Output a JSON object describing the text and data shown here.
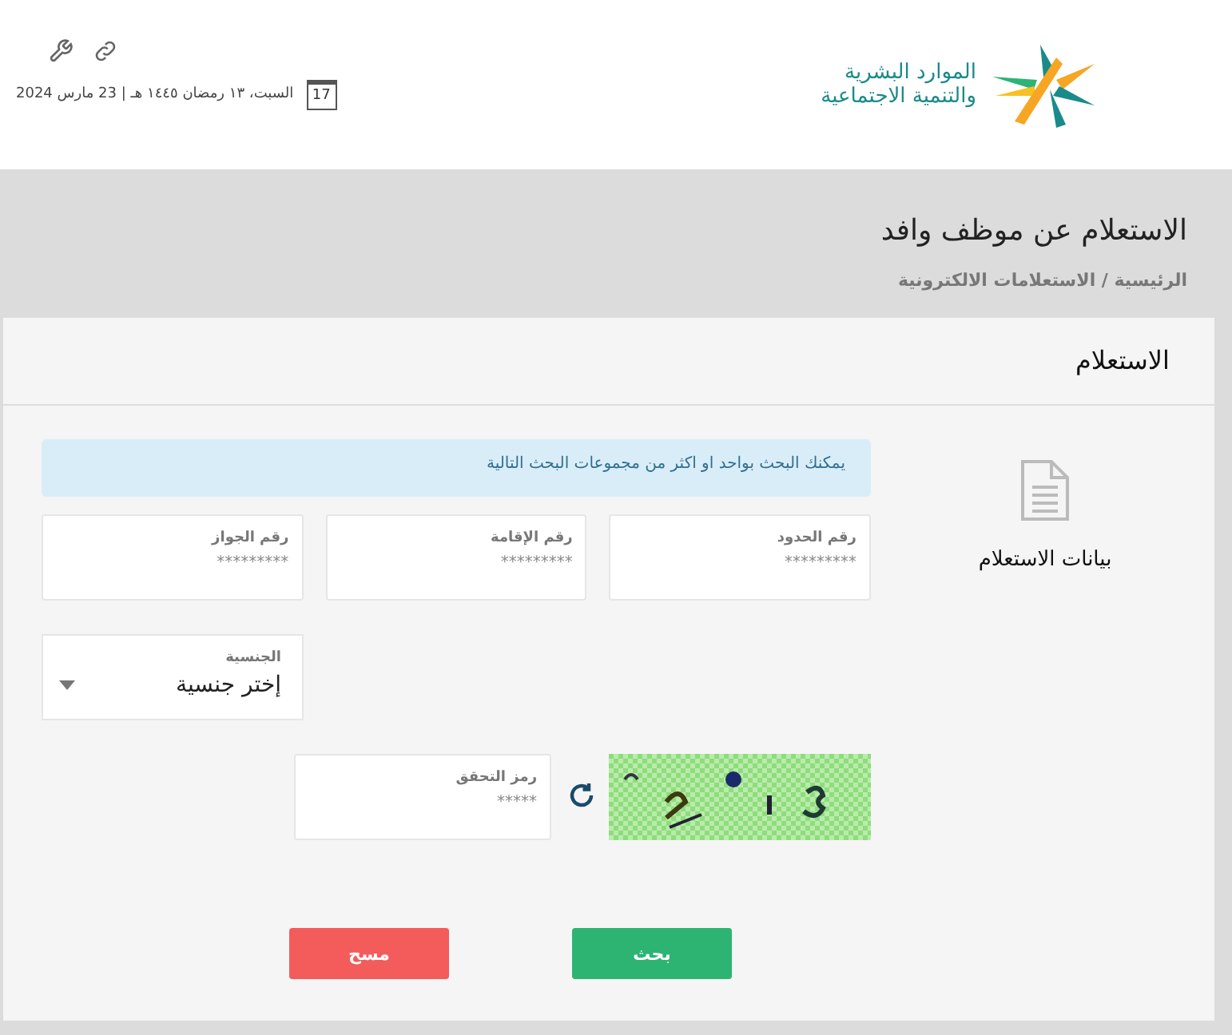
{
  "header": {
    "logo_lines": [
      "الموارد البشرية",
      "والتنمية الاجتماعية"
    ],
    "calendar_day": "17",
    "date": "السبت، ١٣ رمضان ١٤٤٥ هـ | 23 مارس 2024"
  },
  "page": {
    "title": "الاستعلام عن موظف وافد",
    "breadcrumb": "الرئيسية / الاستعلامات الالكترونية"
  },
  "card": {
    "title": "الاستعلام",
    "section_label": "بيانات الاستعلام",
    "info": "يمكنك البحث بواحد او اكثر من مجموعات البحث التالية",
    "fields": [
      {
        "label": "رقم الحدود",
        "placeholder": "*********"
      },
      {
        "label": "رقم الإقامة",
        "placeholder": "*********"
      },
      {
        "label": "رقم الجواز",
        "placeholder": "*********"
      }
    ],
    "nationality": {
      "label": "الجنسية",
      "value": "إختر جنسية"
    },
    "captcha": {
      "label": "رمز التحقق",
      "placeholder": "*****"
    },
    "buttons": [
      {
        "label": "بحث",
        "kind": "primary"
      },
      {
        "label": "مسح",
        "kind": "danger"
      }
    ]
  }
}
